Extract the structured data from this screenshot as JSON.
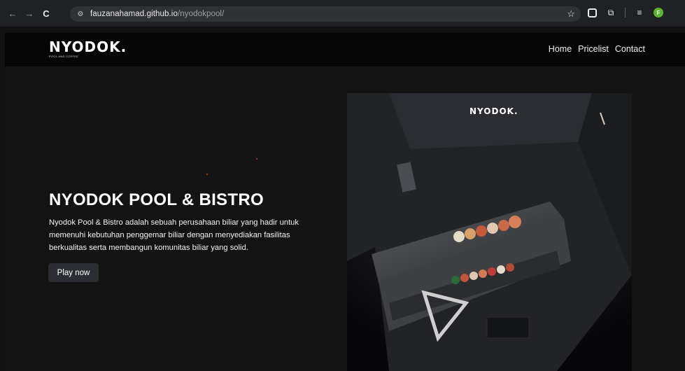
{
  "browser": {
    "url_host": "fauzanahamad.github.io",
    "url_path": "/nyodokpool/",
    "avatar_letter": "F"
  },
  "site": {
    "logo_text": "NYODOK.",
    "logo_subtext": "POOL AND COFFEE",
    "nav": [
      "Home",
      "Pricelist",
      "Contact"
    ]
  },
  "hero": {
    "title": "NYODOK POOL & BISTRO",
    "description_lines": [
      "Nyodok Pool & Bistro adalah sebuah perusahaan biliar yang hadir untuk",
      "memenuhi kebutuhan penggemar biliar dengan menyediakan fasilitas",
      "berkualitas serta membangun komunitas biliar yang solid."
    ],
    "cta_label": "Play now",
    "photo_logo_text": "NYODOK."
  },
  "colors": {
    "browser_bg": "#202124",
    "page_bg": "#131313",
    "nav_bg": "#050505",
    "button_bg": "#2a2d33",
    "accent_dot": "#d93a2a"
  }
}
